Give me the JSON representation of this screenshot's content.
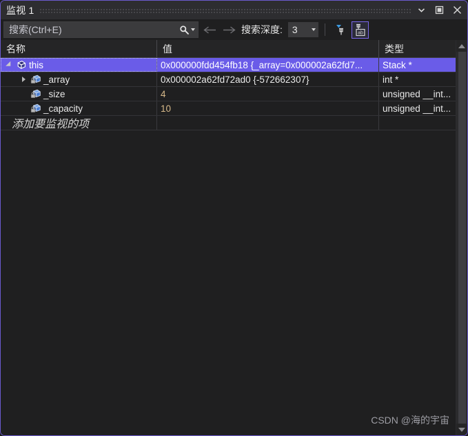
{
  "window": {
    "title": "监视 1",
    "border_color": "#6a5acd",
    "titlebar_buttons": [
      {
        "name": "dropdown-icon",
        "glyph": "chevron-down"
      },
      {
        "name": "maximize-icon",
        "glyph": "square"
      },
      {
        "name": "close-icon",
        "glyph": "x"
      }
    ]
  },
  "toolbar": {
    "search_placeholder": "搜索(Ctrl+E)",
    "search_value": "",
    "search_icon": "search-icon",
    "search_dropdown_icon": "chevron-down-icon",
    "back_icon": "arrow-left-icon",
    "forward_icon": "arrow-right-icon",
    "depth_label": "搜索深度:",
    "depth_value": "3",
    "depth_dropdown_icon": "chevron-down-icon",
    "pin_filter_icon": "pin-filter-icon",
    "pin_ab_icon": "pin-text-icon",
    "pin_ab_active": true,
    "active_border_color": "#7b68ee"
  },
  "grid": {
    "columns": [
      {
        "key": "name",
        "label": "名称"
      },
      {
        "key": "value",
        "label": "值"
      },
      {
        "key": "type",
        "label": "类型"
      }
    ],
    "rows": [
      {
        "name": "this",
        "value": "0x000000fdd454fb18 {_array=0x000002a62fd7...",
        "type": "Stack *",
        "depth": 0,
        "twisty": "expanded",
        "icon": "object-cube-icon",
        "selected": true,
        "value_kind": "plain"
      },
      {
        "name": "_array",
        "value": "0x000002a62fd72ad0 {-572662307}",
        "type": "int *",
        "depth": 1,
        "twisty": "collapsed",
        "icon": "private-field-icon",
        "selected": false,
        "value_kind": "plain"
      },
      {
        "name": "_size",
        "value": "4",
        "type": "unsigned __int...",
        "depth": 1,
        "twisty": "none",
        "icon": "private-field-icon",
        "selected": false,
        "value_kind": "number"
      },
      {
        "name": "_capacity",
        "value": "10",
        "type": "unsigned __int...",
        "depth": 1,
        "twisty": "none",
        "icon": "private-field-icon",
        "selected": false,
        "value_kind": "number"
      }
    ],
    "add_row_placeholder": "添加要监视的项",
    "selection_color": "#6a5ce8",
    "number_value_color": "#d7b98a"
  },
  "scrollbar": {
    "up_icon": "scroll-up-arrow-icon",
    "down_icon": "scroll-down-arrow-icon"
  },
  "watermark": {
    "text": "CSDN @海的宇宙"
  }
}
